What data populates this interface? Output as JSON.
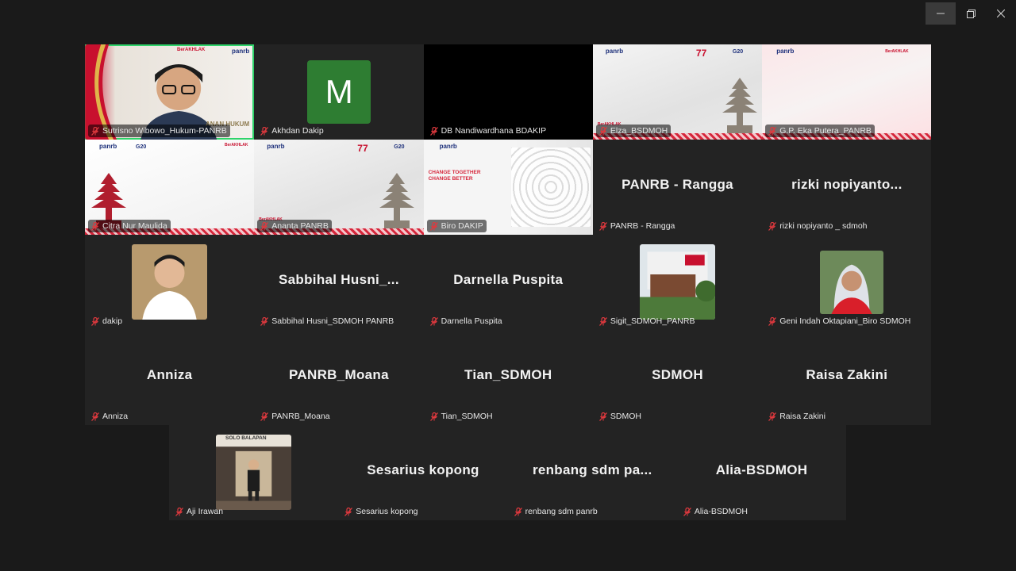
{
  "window": {
    "controls": [
      "minimize",
      "restore",
      "close"
    ]
  },
  "slide_text": {
    "panrb": "panrb",
    "berakhlak": "BerAKHLAK",
    "g20": "G20",
    "seventy_seven": "77",
    "change_line1": "CHANGE TOGETHER",
    "change_line2": "CHANGE BETTER",
    "hukum_caption": "ANAN HUKUM",
    "station_sign": "SOLO BALAPAN"
  },
  "participants": [
    {
      "label": "Sutrisno Wibowo_Hukum-PANRB",
      "type": "video-person",
      "active": true
    },
    {
      "label": "Akhdan Dakip",
      "type": "avatar",
      "initial": "M",
      "avatar_color": "#2e7d32"
    },
    {
      "label": "DB Nandiwardhana BDAKIP",
      "type": "black"
    },
    {
      "label": "Elza_BSDMOH",
      "type": "slide-gray-temple"
    },
    {
      "label": "G.P. Eka Putera_PANRB",
      "type": "slide-pink"
    },
    {
      "label": "Citra Nur Maulida",
      "type": "slide-white-temple"
    },
    {
      "label": "Ananta PANRB",
      "type": "slide-gray-temple2"
    },
    {
      "label": "Biro DAKIP",
      "type": "slide-change"
    },
    {
      "label": "PANRB - Rangga",
      "type": "name",
      "display": "PANRB - Rangga"
    },
    {
      "label": "rizki nopiyanto _ sdmoh",
      "type": "name",
      "display": "rizki  nopiyanto..."
    },
    {
      "label": "dakip",
      "type": "photo-person"
    },
    {
      "label": "Sabbihal Husni_SDMOH PANRB",
      "type": "name",
      "display": "Sabbihal  Husni_..."
    },
    {
      "label": "Darnella Puspita",
      "type": "name",
      "display": "Darnella Puspita"
    },
    {
      "label": "Sigit_SDMOH_PANRB",
      "type": "photo-building"
    },
    {
      "label": "Geni Indah Oktapiani_Biro SDMOH",
      "type": "photo-hijab"
    },
    {
      "label": "Anniza",
      "type": "name",
      "display": "Anniza"
    },
    {
      "label": "PANRB_Moana",
      "type": "name",
      "display": "PANRB_Moana"
    },
    {
      "label": "Tian_SDMOH",
      "type": "name",
      "display": "Tian_SDMOH"
    },
    {
      "label": "SDMOH",
      "type": "name",
      "display": "SDMOH"
    },
    {
      "label": "Raisa Zakini",
      "type": "name",
      "display": "Raisa Zakini"
    },
    {
      "label": "Aji Irawan",
      "type": "photo-station"
    },
    {
      "label": "Sesarius kopong",
      "type": "name",
      "display": "Sesarius kopong"
    },
    {
      "label": "renbang sdm panrb",
      "type": "name",
      "display": "renbang  sdm  pa..."
    },
    {
      "label": "Alia-BSDMOH",
      "type": "name",
      "display": "Alia-BSDMOH"
    }
  ],
  "colors": {
    "active_border": "#2fd36a",
    "muted_mic": "#e0393e",
    "tile_bg": "#232323"
  }
}
